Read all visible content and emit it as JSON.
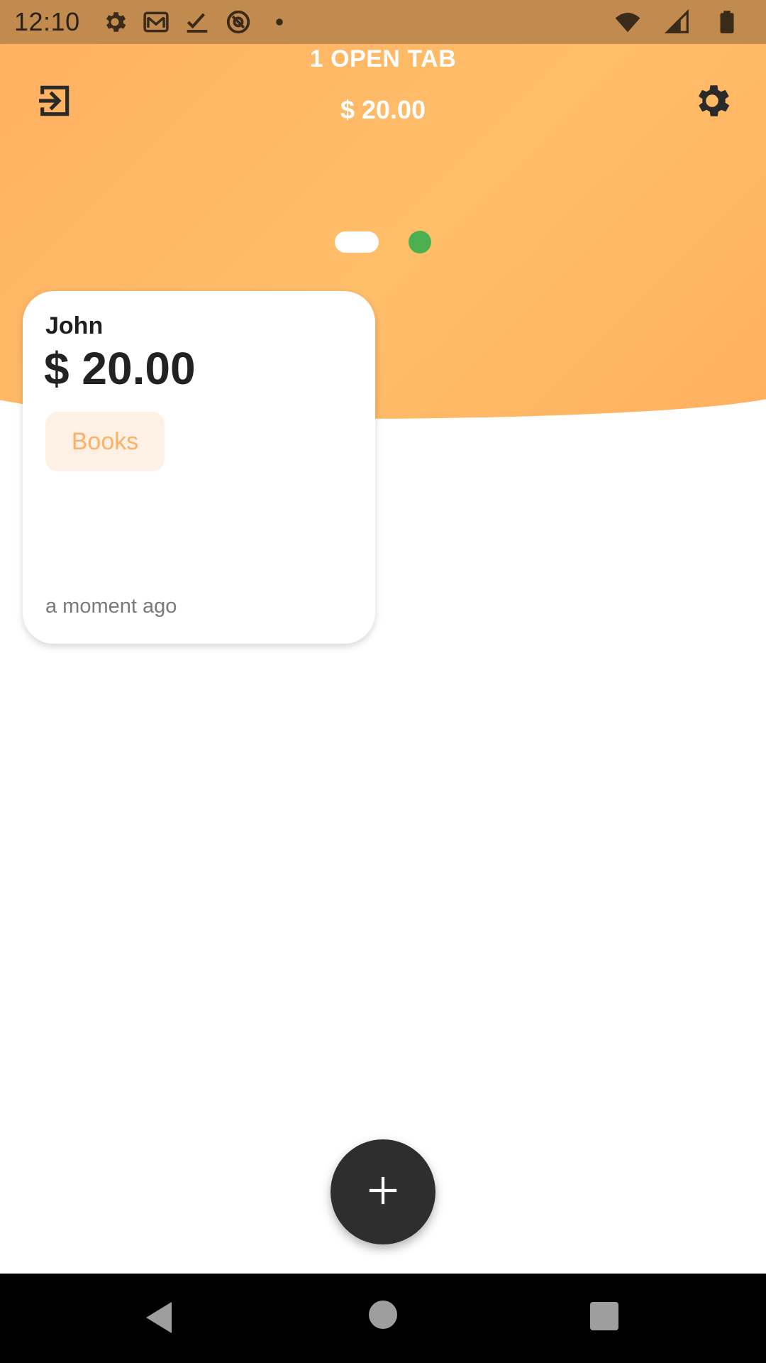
{
  "status_bar": {
    "time": "12:10",
    "icons": [
      "settings-icon",
      "gmail-icon",
      "checkmark-icon",
      "at-sign-icon",
      "dot-icon"
    ],
    "right_icons": [
      "wifi-icon",
      "cell-signal-icon",
      "battery-icon"
    ]
  },
  "header": {
    "title": "1 OPEN TAB",
    "total": "$ 20.00",
    "exit_icon": "exit-icon",
    "settings_icon": "gear-icon"
  },
  "pager": {
    "pages": 2,
    "active_index": 0,
    "active_color": "#FFFFFF",
    "inactive_color": "#4CAF50"
  },
  "tabs": [
    {
      "name": "John",
      "amount": "$ 20.00",
      "category": "Books",
      "time": "a moment ago"
    }
  ],
  "fab": {
    "icon": "plus-icon"
  },
  "nav_bar": {
    "back": "back-icon",
    "home": "home-icon",
    "recents": "recents-icon"
  },
  "colors": {
    "header": "#FFB965",
    "status_bar": "#C18B4F",
    "tag_bg": "#FDF0E4",
    "tag_text": "#FFB067",
    "fab": "#2E2E2E"
  }
}
